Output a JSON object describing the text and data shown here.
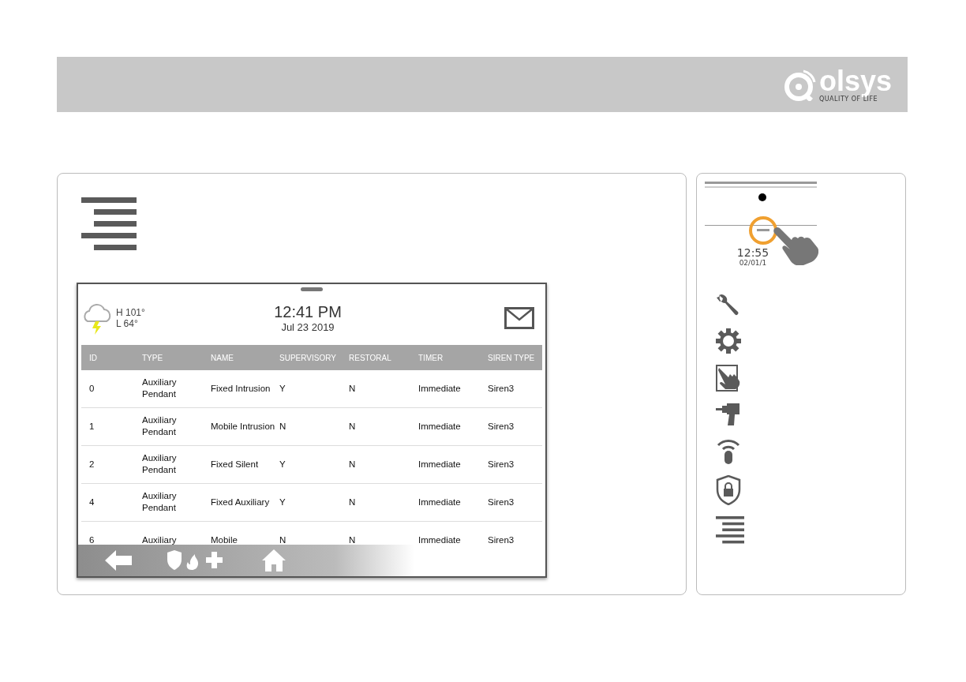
{
  "brand": {
    "name": "olsys",
    "tagline": "QUALITY OF LIFE"
  },
  "panel": {
    "weather": {
      "high": "H 101°",
      "low": "L 64°"
    },
    "time": "12:41 PM",
    "date": "Jul 23 2019",
    "table": {
      "columns": [
        "ID",
        "TYPE",
        "NAME",
        "SUPERVISORY",
        "RESTORAL",
        "TIMER",
        "SIREN TYPE"
      ],
      "rows": [
        {
          "cells": [
            "0",
            "Auxiliary Pendant",
            "Fixed Intrusion",
            "Y",
            "N",
            "Immediate",
            "Siren3"
          ]
        },
        {
          "cells": [
            "1",
            "Auxiliary Pendant",
            "Mobile Intrusion",
            "N",
            "N",
            "Immediate",
            "Siren3"
          ]
        },
        {
          "cells": [
            "2",
            "Auxiliary Pendant",
            "Fixed Silent",
            "Y",
            "N",
            "Immediate",
            "Siren3"
          ]
        },
        {
          "cells": [
            "4",
            "Auxiliary Pendant",
            "Fixed Auxiliary",
            "Y",
            "N",
            "Immediate",
            "Siren3"
          ]
        },
        {
          "cells": [
            "6",
            "Auxiliary",
            "Mobile",
            "N",
            "N",
            "Immediate",
            "Siren3"
          ]
        }
      ]
    }
  },
  "drawer_preview": {
    "time": "12:55",
    "date": "02/01/1"
  }
}
